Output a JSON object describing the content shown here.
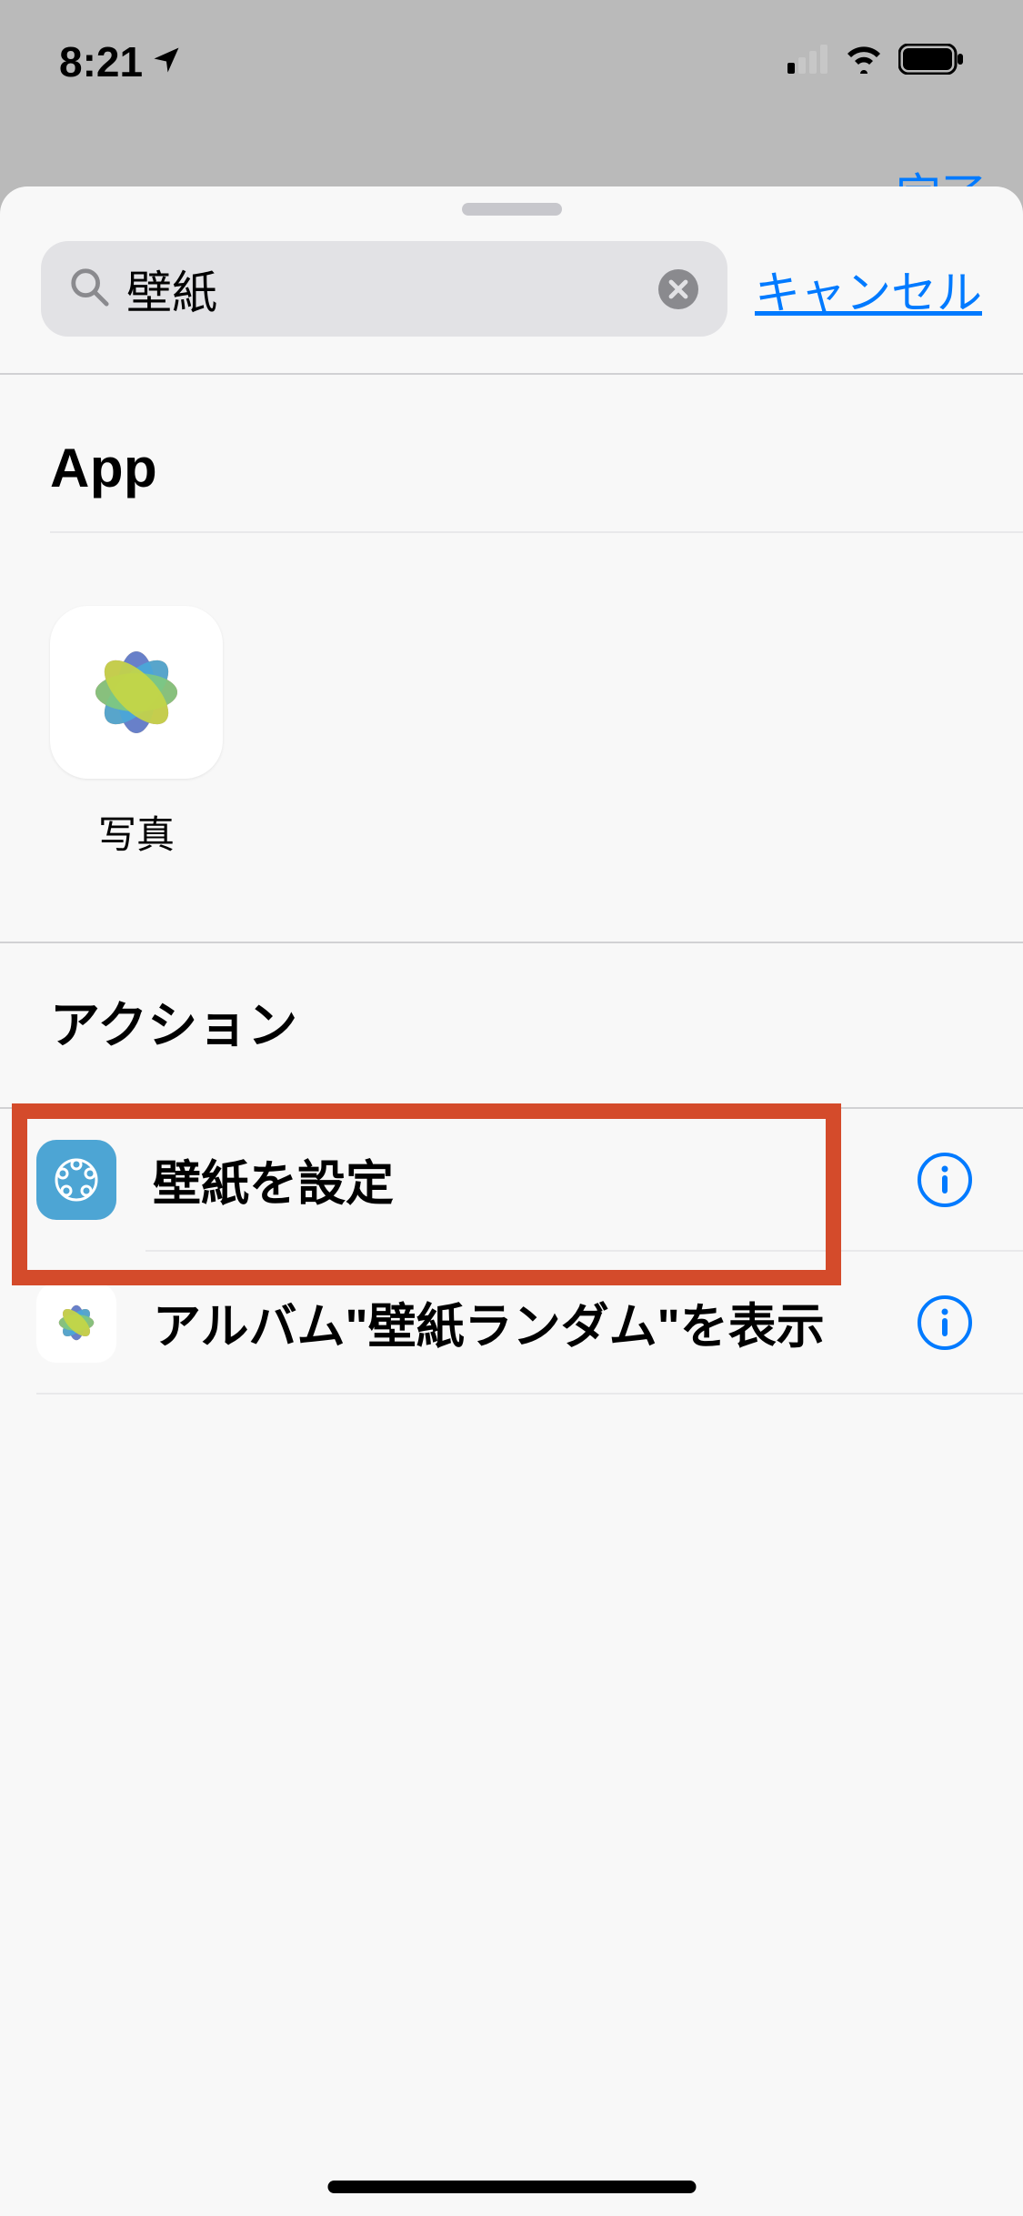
{
  "status": {
    "time": "8:21"
  },
  "background": {
    "done_label": "完了"
  },
  "search": {
    "value": "壁紙",
    "cancel_label": "キャンセル"
  },
  "sections": {
    "app": {
      "title": "App",
      "items": [
        {
          "label": "写真"
        }
      ]
    },
    "actions": {
      "title": "アクション",
      "items": [
        {
          "label": "壁紙を設定"
        },
        {
          "label": "アルバム\"壁紙ランダム\"を表示"
        }
      ]
    }
  }
}
